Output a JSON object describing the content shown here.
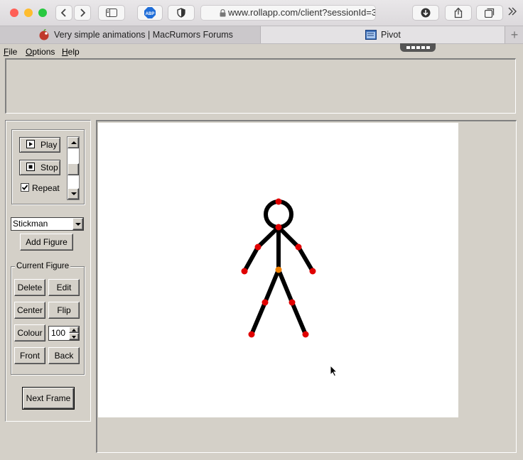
{
  "browser": {
    "address_url": "www.rollapp.com/client?sessionId=3",
    "adblock_label": "ABP",
    "tabs": [
      {
        "title": "Very simple animations | MacRumors Forums",
        "active": false
      },
      {
        "title": "Pivot",
        "active": true
      }
    ],
    "new_tab_label": "+"
  },
  "app": {
    "menu": [
      {
        "label": "File",
        "accel": "F",
        "rest": "ile"
      },
      {
        "label": "Options",
        "accel": "O",
        "rest": "ptions"
      },
      {
        "label": "Help",
        "accel": "H",
        "rest": "elp"
      }
    ],
    "playback": {
      "play_label": "Play",
      "stop_label": "Stop",
      "repeat_label": "Repeat",
      "repeat_checked": true
    },
    "figure_select": {
      "value": "Stickman"
    },
    "add_figure_label": "Add Figure",
    "current_figure": {
      "legend": "Current Figure",
      "delete_label": "Delete",
      "edit_label": "Edit",
      "center_label": "Center",
      "flip_label": "Flip",
      "colour_label": "Colour",
      "size_value": "100",
      "front_label": "Front",
      "back_label": "Back"
    },
    "next_frame_label": "Next Frame"
  },
  "colors": {
    "joint": "#e00000",
    "pivot_joint": "#f08000",
    "limb": "#000000"
  }
}
